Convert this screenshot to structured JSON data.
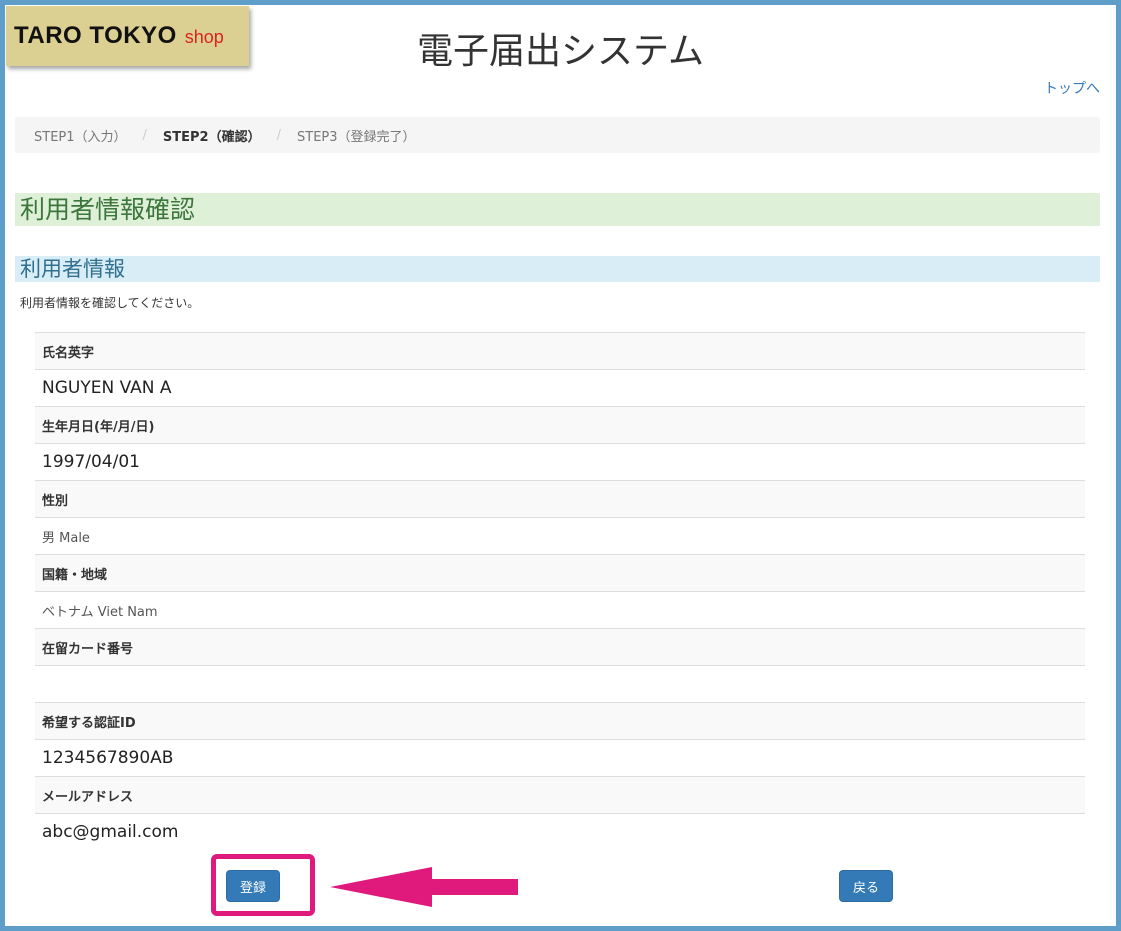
{
  "brand": {
    "name": "TARO TOKYO",
    "sub": "shop"
  },
  "header": {
    "title": "電子届出システム",
    "top_link": "トップへ"
  },
  "steps": [
    {
      "label": "STEP1（入力）",
      "active": false
    },
    {
      "label": "STEP2（確認）",
      "active": true
    },
    {
      "label": "STEP3（登録完了）",
      "active": false
    }
  ],
  "page": {
    "heading": "利用者情報確認",
    "section_title": "利用者情報",
    "instruction": "利用者情報を確認してください。"
  },
  "fields": [
    {
      "label": "氏名英字",
      "value": "NGUYEN VAN A",
      "style": "big"
    },
    {
      "label": "生年月日(年/月/日)",
      "value": "1997/04/01",
      "style": "big"
    },
    {
      "label": "性別",
      "value": "男 Male",
      "style": "small"
    },
    {
      "label": "国籍・地域",
      "value": "ベトナム Viet Nam",
      "style": "small"
    },
    {
      "label": "在留カード番号",
      "value": "",
      "style": "small"
    },
    {
      "label": "希望する認証ID",
      "value": "1234567890AB",
      "style": "big"
    },
    {
      "label": "メールアドレス",
      "value": "abc@gmail.com",
      "style": "big"
    }
  ],
  "buttons": {
    "register": "登録",
    "back": "戻る"
  },
  "colors": {
    "frame": "#5f9ec8",
    "badge": "#dccf92",
    "heading_bg": "#dff0d8",
    "section_bg": "#d9edf7",
    "button": "#337ab7",
    "highlight": "#e0197d"
  }
}
